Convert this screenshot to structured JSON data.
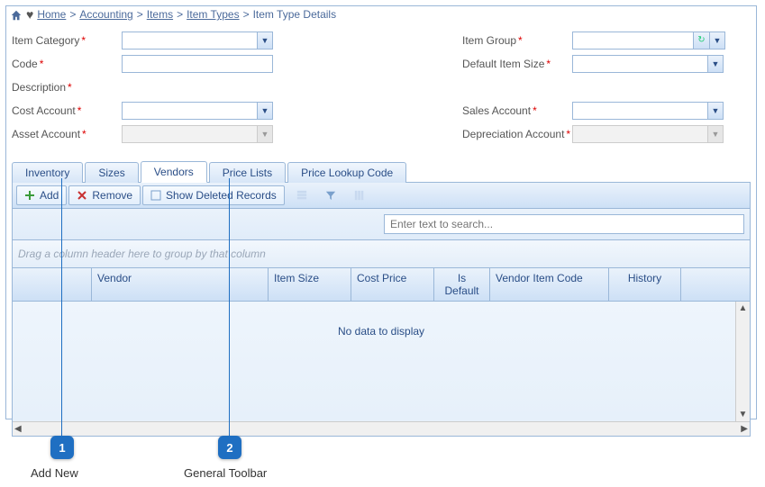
{
  "breadcrumb": {
    "home": "Home",
    "l1": "Accounting",
    "l2": "Items",
    "l3": "Item Types",
    "current": "Item Type Details"
  },
  "form": {
    "item_category": "Item Category",
    "code": "Code",
    "description": "Description",
    "cost_account": "Cost Account",
    "asset_account": "Asset Account",
    "item_group": "Item Group",
    "default_item_size": "Default Item Size",
    "sales_account": "Sales Account",
    "depreciation_account": "Depreciation Account"
  },
  "tabs": {
    "inventory": "Inventory",
    "sizes": "Sizes",
    "vendors": "Vendors",
    "price_lists": "Price Lists",
    "price_lookup": "Price Lookup Code"
  },
  "toolbar": {
    "add": "Add",
    "remove": "Remove",
    "show_deleted": "Show Deleted Records"
  },
  "search": {
    "placeholder": "Enter text to search..."
  },
  "grid": {
    "group_hint": "Drag a column header here to group by that column",
    "cols": {
      "vendor": "Vendor",
      "item_size": "Item Size",
      "cost_price": "Cost Price",
      "is_default": "Is Default",
      "vendor_item_code": "Vendor Item Code",
      "history": "History"
    },
    "no_data": "No data to display"
  },
  "callouts": {
    "n1": "1",
    "n2": "2",
    "l1": "Add New",
    "l2": "General Toolbar"
  }
}
